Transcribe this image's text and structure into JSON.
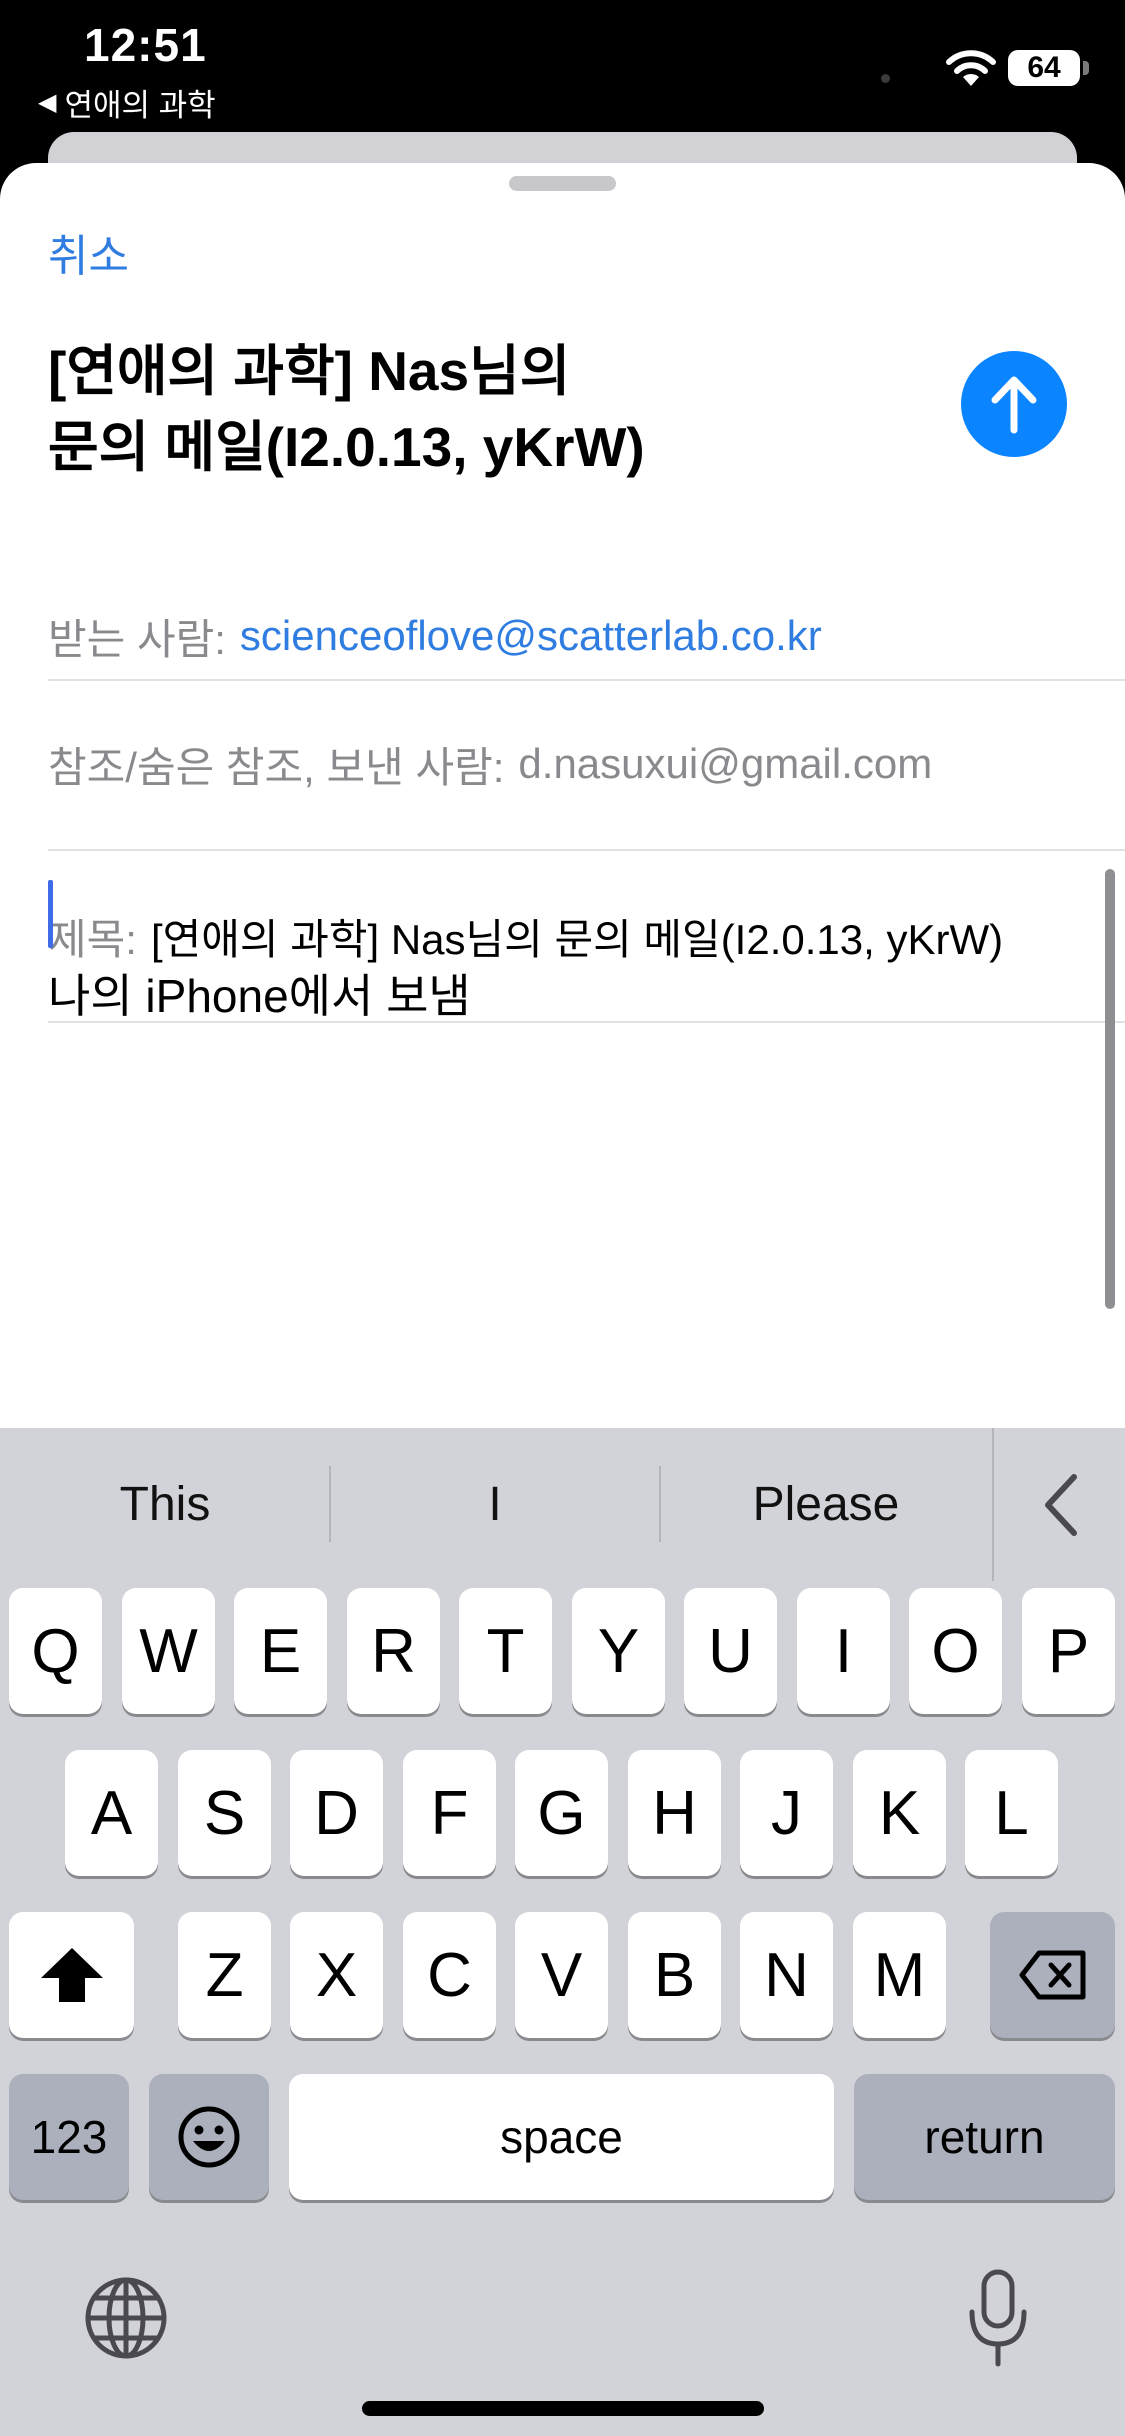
{
  "status_bar": {
    "time": "12:51",
    "back_app": "연애의 과학",
    "battery": "64"
  },
  "compose": {
    "cancel_label": "취소",
    "title_line1": "[연애의 과학] Nas님의",
    "title_line2": "문의 메일(I2.0.13, yKrW)",
    "to_label": "받는 사람:",
    "to_value": "scienceoflove@scatterlab.co.kr",
    "cc_label": "참조/숨은 참조, 보낸 사람:",
    "cc_value": "d.nasuxui@gmail.com",
    "subject_label": "제목:",
    "subject_value": "[연애의 과학] Nas님의 문의 메일(I2.0.13, yKrW)",
    "signature": "나의 iPhone에서 보냄",
    "accent_color": "#0a84ff"
  },
  "keyboard": {
    "suggestions": [
      "This",
      "I",
      "Please"
    ],
    "row1": [
      "Q",
      "W",
      "E",
      "R",
      "T",
      "Y",
      "U",
      "I",
      "O",
      "P"
    ],
    "row2": [
      "A",
      "S",
      "D",
      "F",
      "G",
      "H",
      "J",
      "K",
      "L"
    ],
    "row3": [
      "Z",
      "X",
      "C",
      "V",
      "B",
      "N",
      "M"
    ],
    "numbers_label": "123",
    "space_label": "space",
    "return_label": "return"
  }
}
